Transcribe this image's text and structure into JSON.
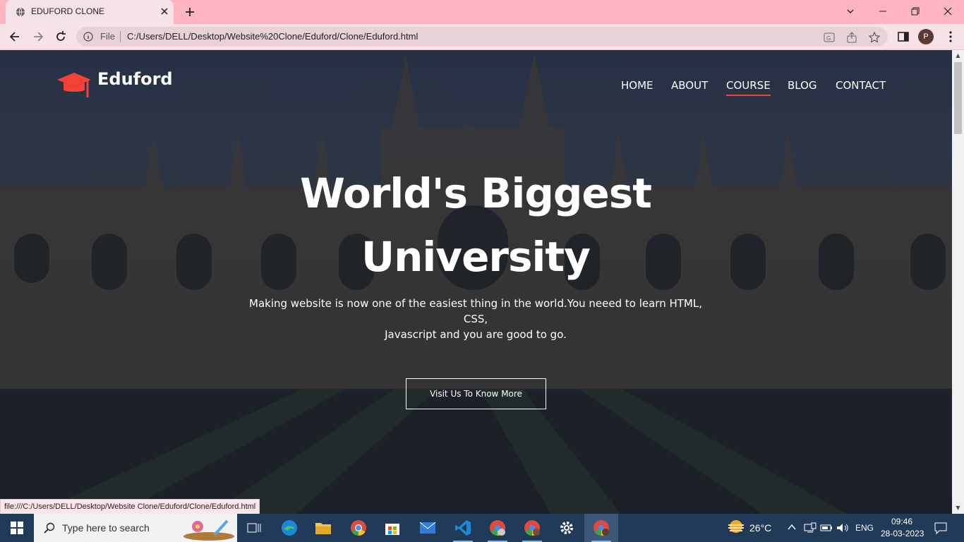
{
  "browser": {
    "tab_title": "EDUFORD CLONE",
    "url_scheme": "File",
    "url": "C:/Users/DELL/Desktop/Website%20Clone/Eduford/Clone/Eduford.html",
    "profile_initial": "P",
    "status_url": "file:///C:/Users/DELL/Desktop/Website Clone/Eduford/Clone/Eduford.html"
  },
  "site": {
    "logo_text": "Eduford",
    "nav": [
      {
        "label": "HOME"
      },
      {
        "label": "ABOUT"
      },
      {
        "label": "COURSE",
        "active": true
      },
      {
        "label": "BLOG"
      },
      {
        "label": "CONTACT"
      }
    ],
    "hero": {
      "title_line1": "World's Biggest",
      "title_line2": "University",
      "subtitle_line1": "Making website is now one of the easiest thing in the world.You neeed to learn HTML,",
      "subtitle_line2": "CSS,",
      "subtitle_line3": "Javascript and you are good to go.",
      "button_label": "Visit Us To Know More"
    },
    "accent_color": "#f44336"
  },
  "taskbar": {
    "search_placeholder": "Type here to search",
    "weather": "26°C",
    "language": "ENG",
    "time": "09:46",
    "date": "28-03-2023",
    "apps": [
      "task-view-icon",
      "edge-icon",
      "file-explorer-icon",
      "chrome-icon",
      "store-icon",
      "mail-icon",
      "vscode-icon",
      "chrome-profile-icon",
      "chrome-profile-icon",
      "settings-icon",
      "chrome-active-icon"
    ]
  }
}
